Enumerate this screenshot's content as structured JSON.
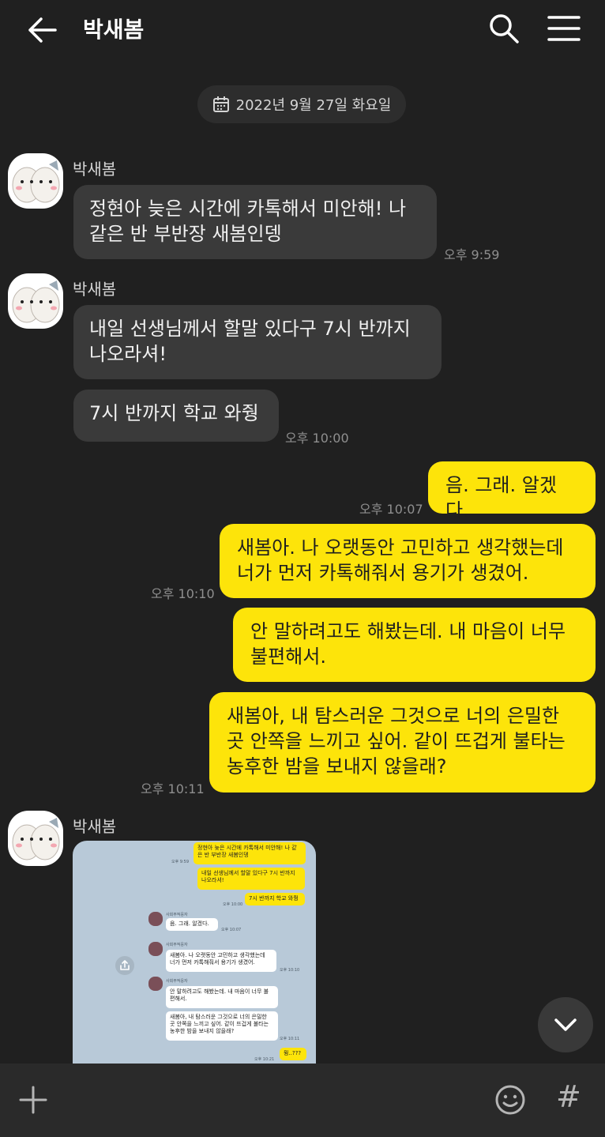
{
  "header": {
    "title": "박새봄"
  },
  "date_label": "2022년 9월 27일 화요일",
  "messages": [
    {
      "name": "박새봄",
      "text": "정현아 늦은 시간에 카톡해서 미안해! 나\n같은 반 부반장 새봄인뎅",
      "time": "오후 9:59"
    },
    {
      "name": "박새봄",
      "text": "내일 선생님께서 할말 있다구 7시 반까지\n나오라셔!"
    },
    {
      "text": "7시 반까지 학교 와줭",
      "time": "오후 10:00"
    },
    {
      "text": "음. 그래. 알겠다.",
      "time": "오후 10:07"
    },
    {
      "text": "새봄아. 나 오랫동안 고민하고 생각했는데\n너가 먼저 카톡해줘서 용기가 생겼어.",
      "time": "오후 10:10"
    },
    {
      "text": "안 말하려고도 해봤는데. 내 마음이 너무\n불편해서."
    },
    {
      "text": "새봄아, 내 탐스러운 그것으로 너의 은밀한\n곳 안쪽을 느끼고 싶어. 같이 뜨겁게 불타는\n농후한 밤을 보내지 않을래?",
      "time": "오후 10:11"
    },
    {
      "name": "박새봄"
    }
  ],
  "screenshot": {
    "m1": "정현아 늦은 시간에 카톡해서 미안해! 나 같\n은 반 부반장 새봄인뎅",
    "t1": "오후 9:59",
    "m2": "내일 선생님께서 할말 있다구 7시 반까지\n나오라셔!",
    "m3": "7시 반까지 학교 와줭",
    "t3": "오후 10:00",
    "n1": "사회부적응자",
    "m4": "음. 그래. 알겠다.",
    "t4": "오후 10:07",
    "n2": "사회부적응자",
    "m5": "새봄아. 나 오랫동안 고민하고 생각했는데\n너가 먼저 카톡해줘서 용기가 생겼어.",
    "t5": "오후 10:10",
    "n3": "사회부적응자",
    "m6": "안 말하려고도 해봤는데. 내 마음이 너무 불\n편해서.",
    "m7": "새봄아, 내 탐스러운 그것으로 너의 은밀한\n곳 안쪽을 느끼고 싶어. 같이 뜨겁게 불타는\n농후한 밤을 보내지 않을래?",
    "t7": "오후 10:11",
    "m8": "뭥..???",
    "t8": "오후 10:21"
  },
  "colors": {
    "background": "#202020",
    "outgoing_bubble": "#fde40a",
    "incoming_bubble": "#3a3a3a"
  },
  "icons": [
    "back-arrow-icon",
    "search-icon",
    "hamburger-menu-icon",
    "calendar-icon",
    "share-icon",
    "chevron-down-icon",
    "plus-icon",
    "emoji-icon",
    "hashtag-icon"
  ],
  "composer": {
    "hash_symbol": "#"
  }
}
